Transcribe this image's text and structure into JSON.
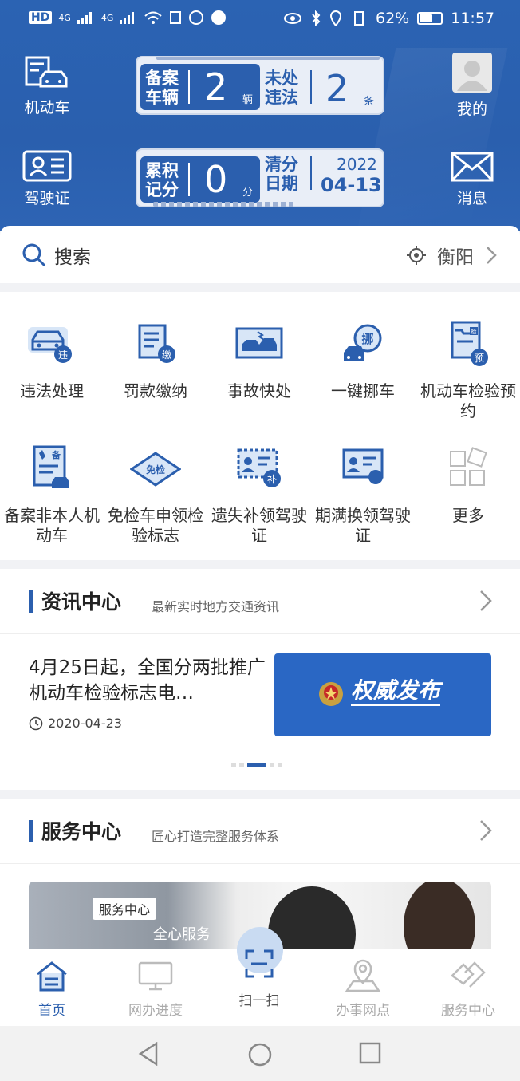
{
  "status_bar": {
    "left_labels": [
      "HD",
      "4G",
      "4G"
    ],
    "battery_percent": 62,
    "battery_text": "62%",
    "time": "11:57"
  },
  "header": {
    "vehicle_label": "机动车",
    "license_label": "驾驶证",
    "mine_label": "我的",
    "message_label": "消息",
    "plate1": {
      "left_label": "备案车辆",
      "left_value": "2",
      "left_unit": "辆",
      "right_label": "未处违法",
      "right_value": "2",
      "right_unit": "条"
    },
    "plate2": {
      "left_label": "累积记分",
      "left_value": "0",
      "left_unit": "分",
      "right_label": "清分日期",
      "year": "2022",
      "date": "04-13"
    }
  },
  "search": {
    "placeholder": "搜索",
    "city": "衡阳"
  },
  "services": [
    {
      "label": "违法处理",
      "badge": "违"
    },
    {
      "label": "罚款缴纳",
      "badge": "缴"
    },
    {
      "label": "事故快处",
      "badge": ""
    },
    {
      "label": "一键挪车",
      "badge": "挪"
    },
    {
      "label": "机动车检验预约",
      "badge": "预",
      "badge_top": "检"
    },
    {
      "label": "备案非本人机动车",
      "badge": "备"
    },
    {
      "label": "免检车申领检验标志",
      "badge": "免检"
    },
    {
      "label": "遗失补领驾驶证",
      "badge": "补"
    },
    {
      "label": "期满换领驾驶证",
      "badge": ""
    },
    {
      "label": "更多",
      "badge": ""
    }
  ],
  "news": {
    "title": "资讯中心",
    "subtitle": "最新实时地方交通资讯",
    "headline": "4月25日起，全国分两批推广机动车检验标志电…",
    "date": "2020-04-23",
    "banner_text": "权威发布"
  },
  "service_center": {
    "title": "服务中心",
    "subtitle": "匠心打造完整服务体系",
    "tag": "服务中心",
    "tag2": "全心服务"
  },
  "tabbar": {
    "tabs": [
      "首页",
      "网办进度",
      "扫一扫",
      "办事网点",
      "服务中心"
    ]
  },
  "colors": {
    "primary": "#2b5fae",
    "banner": "#2a67c4"
  }
}
